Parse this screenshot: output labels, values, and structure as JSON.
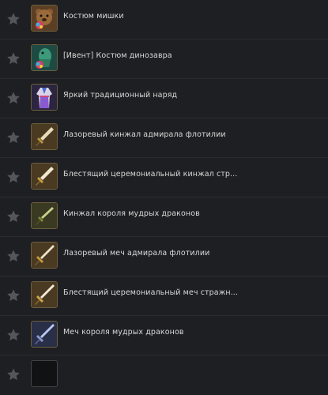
{
  "items": [
    {
      "name": "Костюм мишки",
      "icon": "bear-costume-icon"
    },
    {
      "name": "[Ивент] Костюм динозавра",
      "icon": "dinosaur-costume-icon"
    },
    {
      "name": "Яркий традиционный наряд",
      "icon": "traditional-outfit-icon"
    },
    {
      "name": "Лазоревый кинжал адмирала флотилии",
      "icon": "dagger-icon"
    },
    {
      "name": "Блестящий церемониальный кинжал стр...",
      "icon": "dagger-icon"
    },
    {
      "name": "Кинжал короля мудрых драконов",
      "icon": "dagger-icon"
    },
    {
      "name": "Лазоревый меч адмирала флотилии",
      "icon": "sword-icon"
    },
    {
      "name": "Блестящий церемониальный меч стражн...",
      "icon": "sword-icon"
    },
    {
      "name": "Меч короля мудрых драконов",
      "icon": "sword-icon"
    }
  ],
  "colors": {
    "background": "#1e1f22",
    "star": "#55565b",
    "text": "#d9d9d9"
  }
}
